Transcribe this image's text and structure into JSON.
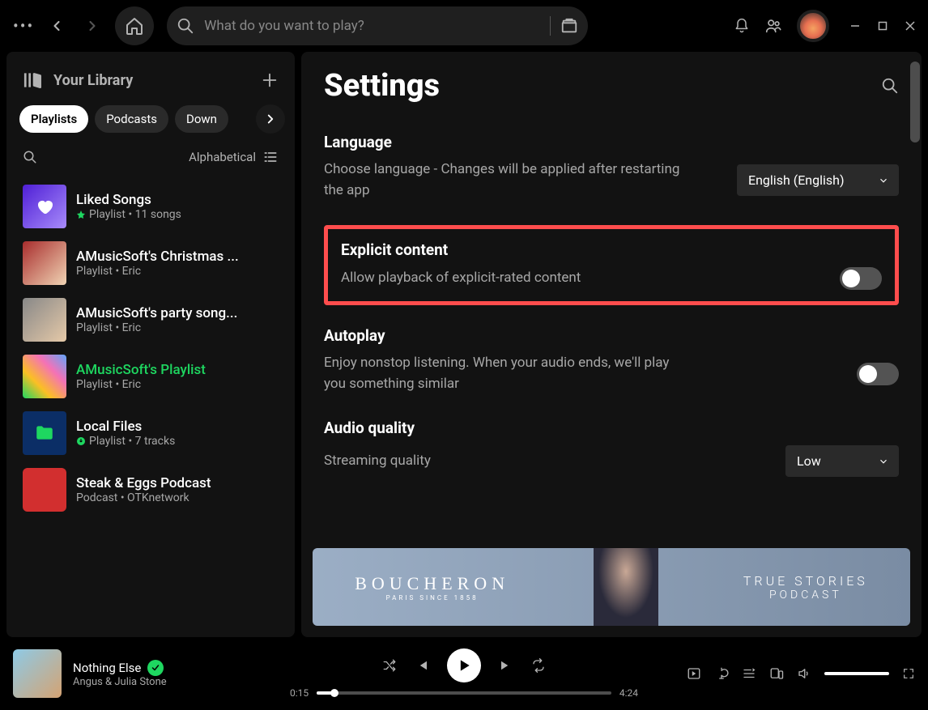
{
  "topbar": {
    "search_placeholder": "What do you want to play?"
  },
  "sidebar": {
    "title": "Your Library",
    "chips": [
      "Playlists",
      "Podcasts",
      "Down"
    ],
    "sort": "Alphabetical",
    "items": [
      {
        "title": "Liked Songs",
        "subtitle": "Playlist • 11 songs",
        "pinned": true
      },
      {
        "title": "AMusicSoft's Christmas ...",
        "subtitle": "Playlist • Eric"
      },
      {
        "title": "AMusicSoft's party song...",
        "subtitle": "Playlist • Eric"
      },
      {
        "title": "AMusicSoft's Playlist",
        "subtitle": "Playlist • Eric",
        "active": true
      },
      {
        "title": "Local Files",
        "subtitle": "Playlist • 7 tracks",
        "downloaded": true
      },
      {
        "title": "Steak & Eggs Podcast",
        "subtitle": "Podcast • OTKnetwork"
      }
    ]
  },
  "page": {
    "title": "Settings",
    "language": {
      "head": "Language",
      "desc": "Choose language - Changes will be applied after restarting the app",
      "value": "English (English)"
    },
    "explicit": {
      "head": "Explicit content",
      "desc": "Allow playback of explicit-rated content"
    },
    "autoplay": {
      "head": "Autoplay",
      "desc": "Enjoy nonstop listening. When your audio ends, we'll play you something similar"
    },
    "audio": {
      "head": "Audio quality",
      "desc": "Streaming quality",
      "value": "Low"
    }
  },
  "ad": {
    "brand": "BOUCHERON",
    "brand_sub": "PARIS SINCE 1858",
    "right1": "TRUE STORIES",
    "right2": "PODCAST"
  },
  "player": {
    "track": "Nothing Else",
    "artist": "Angus & Julia Stone",
    "elapsed": "0:15",
    "duration": "4:24"
  }
}
